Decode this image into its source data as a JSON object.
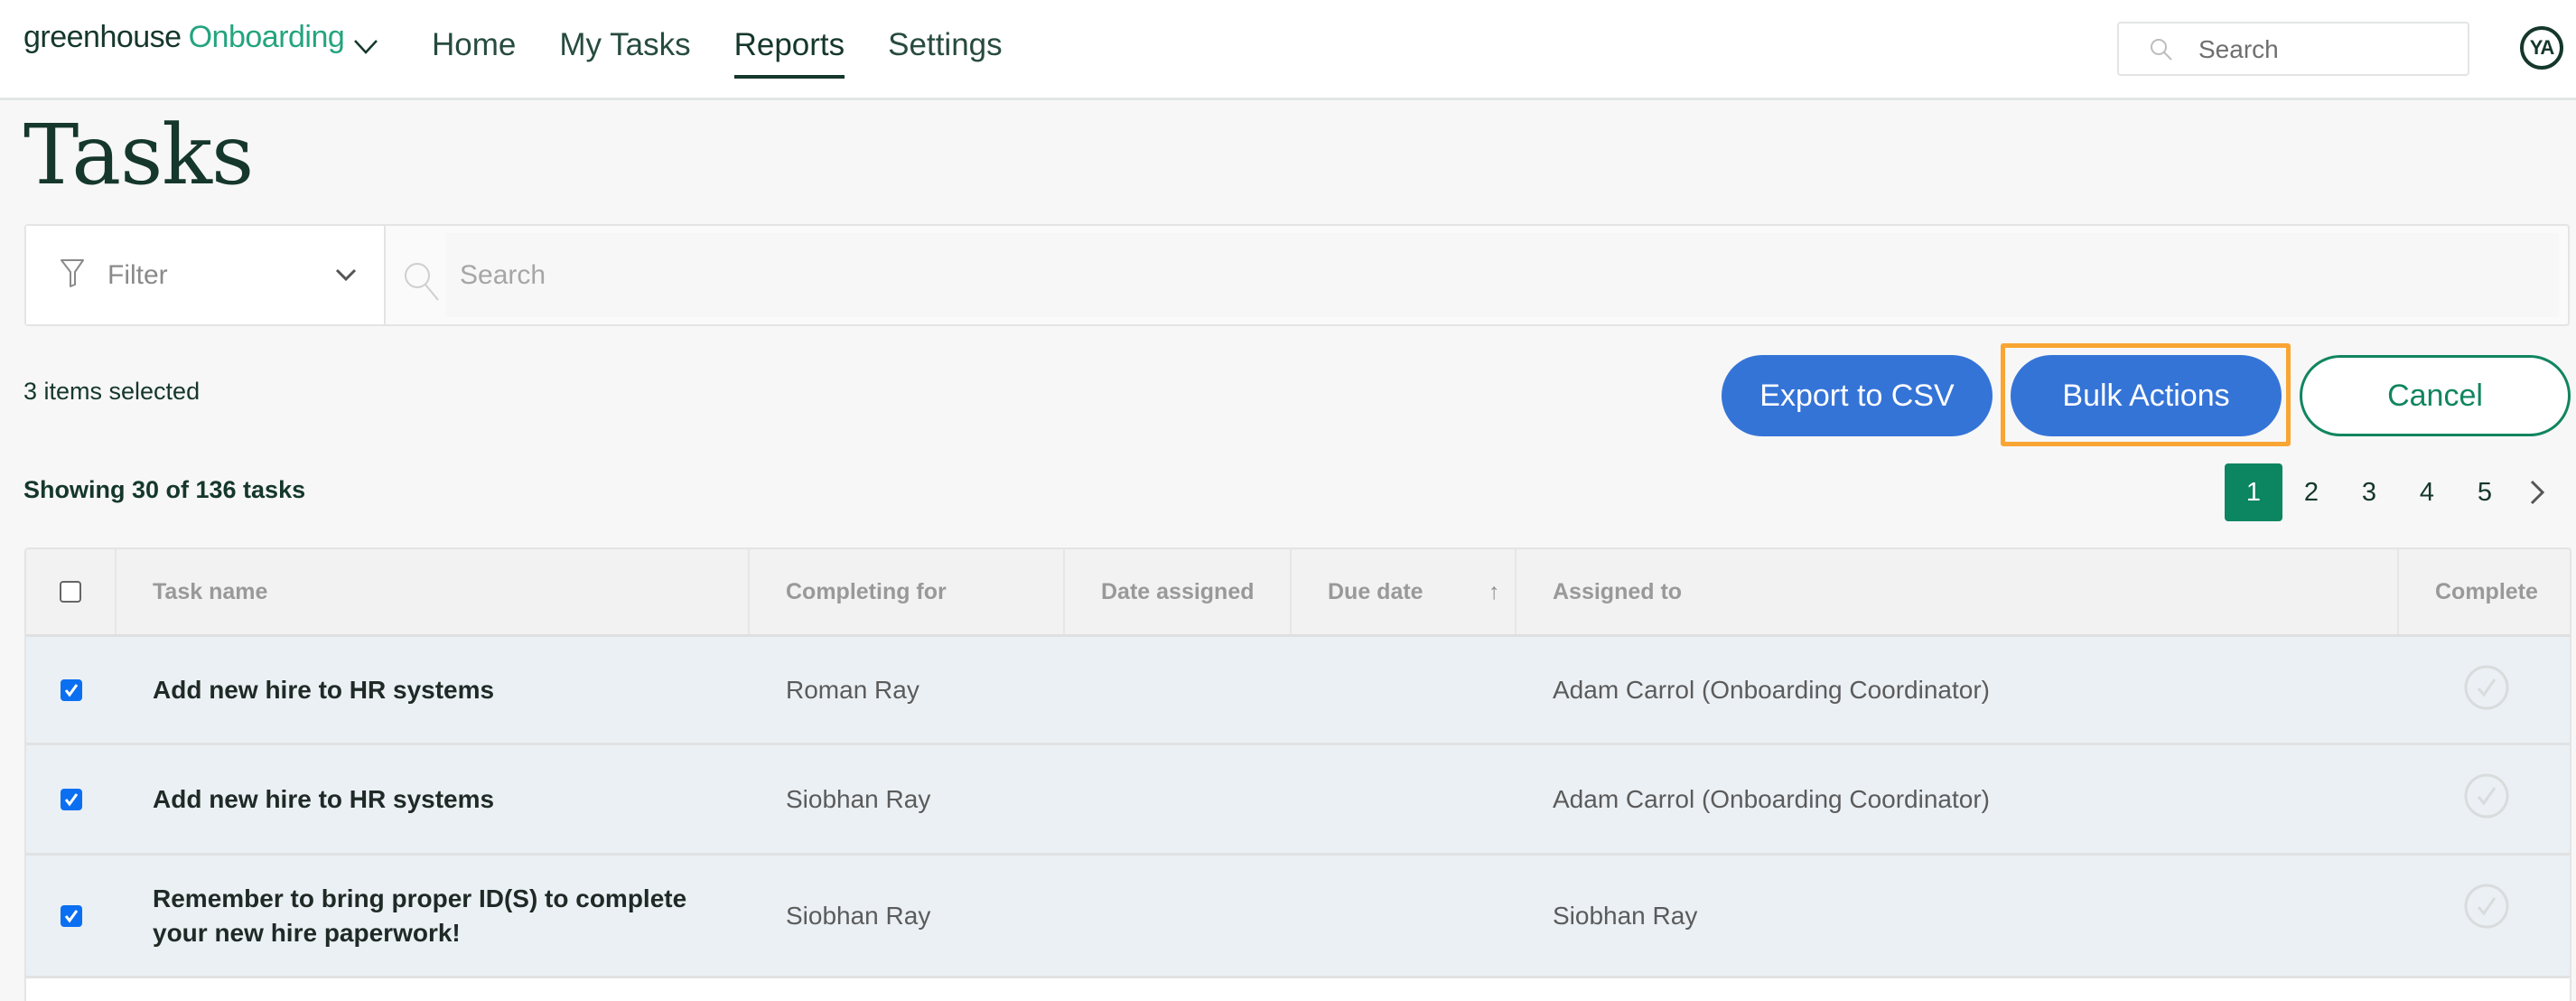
{
  "header": {
    "brand": "greenhouse",
    "product": "Onboarding",
    "nav": [
      {
        "label": "Home",
        "active": false
      },
      {
        "label": "My Tasks",
        "active": false
      },
      {
        "label": "Reports",
        "active": true
      },
      {
        "label": "Settings",
        "active": false
      }
    ],
    "search_placeholder": "Search",
    "avatar_initials": "YA"
  },
  "page": {
    "title": "Tasks",
    "filter_label": "Filter",
    "search_placeholder": "Search",
    "selected_count": "3 items selected",
    "showing": "Showing 30 of 136 tasks"
  },
  "actions": {
    "export_label": "Export to CSV",
    "bulk_label": "Bulk Actions",
    "cancel_label": "Cancel"
  },
  "pagination": {
    "current": "1",
    "pages": [
      "1",
      "2",
      "3",
      "4",
      "5"
    ]
  },
  "table": {
    "columns": [
      "Task name",
      "Completing for",
      "Date assigned",
      "Due date",
      "Assigned to",
      "Complete"
    ],
    "sort_indicator": "↑",
    "rows": [
      {
        "selected": true,
        "task": "Add new hire to HR systems",
        "completing_for": "Roman Ray",
        "date_assigned": "",
        "due_date": "",
        "assigned_to": "Adam Carrol (Onboarding Coordinator)",
        "complete": false
      },
      {
        "selected": true,
        "task": "Add new hire to HR systems",
        "completing_for": "Siobhan Ray",
        "date_assigned": "",
        "due_date": "",
        "assigned_to": "Adam Carrol (Onboarding Coordinator)",
        "complete": false
      },
      {
        "selected": true,
        "task": "Remember to bring proper ID(S) to complete your new hire paperwork!",
        "completing_for": "Siobhan Ray",
        "date_assigned": "",
        "due_date": "",
        "assigned_to": "Siobhan Ray",
        "complete": false
      }
    ]
  },
  "colors": {
    "primary_blue": "#3574d7",
    "brand_green": "#0c8561",
    "dark_green": "#15372c",
    "highlight_orange": "#f9a533",
    "selected_row": "#ebf0f4"
  }
}
